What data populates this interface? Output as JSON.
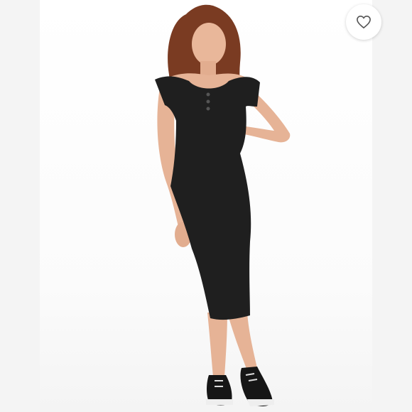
{
  "listing": {
    "photo_alt": "",
    "like_button": {
      "icon": "heart-outline-icon",
      "active": false
    }
  },
  "colors": {
    "background": "#f4f4f4",
    "photo_background": "#ffffff",
    "dress": "#1f1f1f",
    "heart_stroke": "#555555"
  }
}
